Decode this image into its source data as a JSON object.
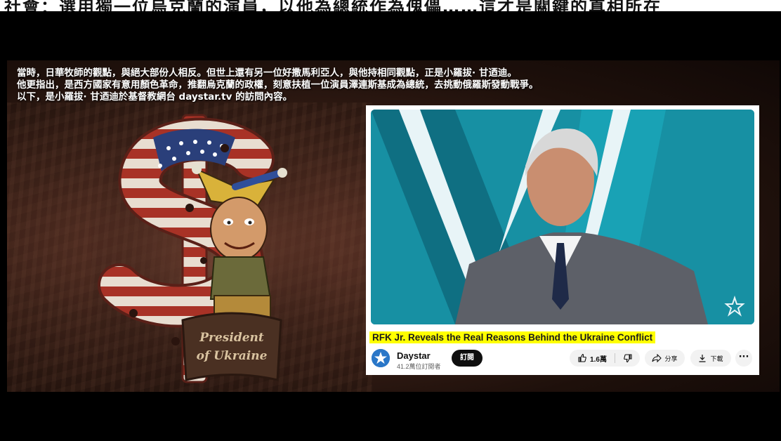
{
  "top_strip": {
    "text": "社會：選用獨一位烏克蘭的演員，以他為總統作為傀儡……這才是關鍵的真相所在"
  },
  "subtitles": {
    "line1": "當時，日華牧師的觀點，與絕大部份人相反。但世上還有另一位好撒馬利亞人，與他持相同觀點，正是小羅拔· 甘迺迪。",
    "line2": "他更指出，是西方國家有意用顏色革命，推翻烏克蘭的政權，刻意扶植一位演員澤連斯基成為總統，去挑動俄羅斯發動戰爭。",
    "line3": "以下，是小羅拔· 甘迺迪於基督教網台 daystar.tv 的訪問內容。"
  },
  "cartoon": {
    "banner_text": "President of Ukraine"
  },
  "youtube": {
    "video_title": "RFK Jr. Reveals the Real Reasons Behind the Ukraine Conflict",
    "channel_name": "Daystar",
    "subscriber_count": "41.2萬位訂閱者",
    "subscribe_label": "訂閱",
    "like_count": "1.6萬",
    "share_label": "分享",
    "download_label": "下載",
    "more_label": "···"
  },
  "colors": {
    "title_highlight": "#ffff00",
    "video_teal": "#1790a3",
    "background_brown": "#3e2219"
  },
  "icons": [
    "like-icon",
    "dislike-icon",
    "share-icon",
    "download-icon",
    "daystar-star-icon"
  ]
}
